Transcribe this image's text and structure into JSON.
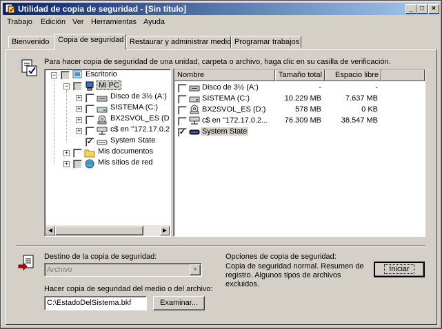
{
  "window": {
    "title": "Utilidad de copia de seguridad - [Sin título]"
  },
  "menu": [
    "Trabajo",
    "Edición",
    "Ver",
    "Herramientas",
    "Ayuda"
  ],
  "tabs": [
    "Bienvenido",
    "Copia de seguridad",
    "Restaurar y administrar medios",
    "Programar trabajos"
  ],
  "instruction": "Para hacer copia de seguridad de una unidad, carpeta o archivo, haga clic en su casilla de verificación.",
  "tree": [
    {
      "label": "Escritorio",
      "icon": "desktop-icon"
    },
    {
      "label": "Mi PC",
      "icon": "computer-icon"
    },
    {
      "label": "Disco de 3½ (A:)",
      "icon": "floppy-drive-icon"
    },
    {
      "label": "SISTEMA (C:)",
      "icon": "hard-drive-icon"
    },
    {
      "label": "BX2SVOL_ES (D",
      "icon": "cd-drive-icon"
    },
    {
      "label": "c$ en ''172.17.0.2",
      "icon": "network-drive-icon"
    },
    {
      "label": "System State",
      "icon": "system-state-icon"
    },
    {
      "label": "Mis documentos",
      "icon": "folder-icon"
    },
    {
      "label": "Mis sitios de red",
      "icon": "network-places-icon"
    }
  ],
  "list": {
    "columns": [
      "Nombre",
      "Tamaño total",
      "Espacio libre"
    ],
    "rows": [
      {
        "name": "Disco de 3½ (A:)",
        "total": "-",
        "free": "-",
        "checked": false
      },
      {
        "name": "SISTEMA (C:)",
        "total": "10.229 MB",
        "free": "7.637 MB",
        "checked": false
      },
      {
        "name": "BX2SVOL_ES (D:)",
        "total": "578 MB",
        "free": "0 KB",
        "checked": false
      },
      {
        "name": "c$ en ''172.17.0.2...",
        "total": "76.309 MB",
        "free": "38.547 MB",
        "checked": false
      },
      {
        "name": "System State",
        "total": "",
        "free": "",
        "checked": true
      }
    ]
  },
  "destination": {
    "label": "Destino de la copia de seguridad:",
    "value": "Archivo",
    "media_label": "Hacer copia de seguridad del medio o del archivo:",
    "media_value": "C:\\EstadoDelSistema.bkf",
    "browse": "Examinar..."
  },
  "options": {
    "label": "Opciones de copia de seguridad:",
    "text": "Copia de seguridad normal.  Resumen de registro.  Algunos tipos de archivos excluidos.",
    "start": "Iniciar"
  }
}
